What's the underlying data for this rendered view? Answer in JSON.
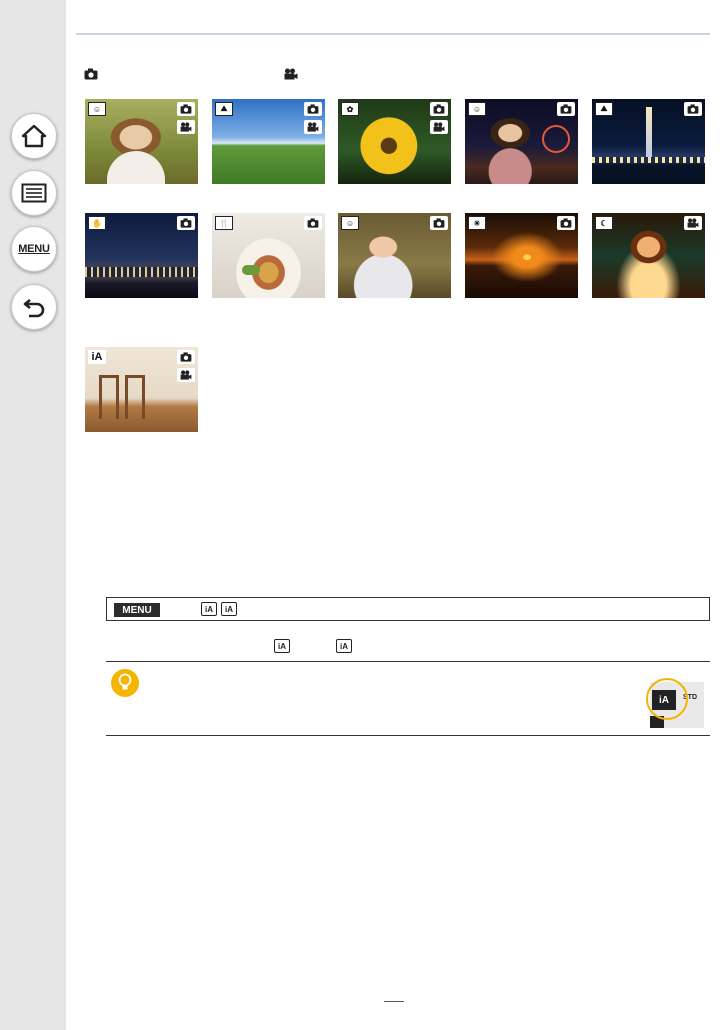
{
  "page": {
    "background": "#ffffff",
    "sidebar_color": "#e6e6e6",
    "rule_color": "#c9d3e3"
  },
  "sidebar": {
    "buttons": [
      {
        "name": "home",
        "icon": "home-icon"
      },
      {
        "name": "contents",
        "icon": "list-icon"
      },
      {
        "name": "menu",
        "icon": "menu-text-icon",
        "label": "MENU"
      },
      {
        "name": "back",
        "icon": "return-arrow-icon"
      }
    ]
  },
  "mode_legend": {
    "photo_icon": "camera-icon",
    "video_icon": "movie-camera-icon"
  },
  "scenes": [
    {
      "id": "portrait",
      "icon": "portrait-scene-icon",
      "photo": true,
      "video": true
    },
    {
      "id": "scenery",
      "icon": "scenery-scene-icon",
      "photo": true,
      "video": true
    },
    {
      "id": "macro",
      "icon": "macro-scene-icon",
      "photo": true,
      "video": true
    },
    {
      "id": "night-portrait",
      "icon": "night-portrait-scene-icon",
      "photo": true,
      "video": false
    },
    {
      "id": "night-scenery",
      "icon": "night-scenery-scene-icon",
      "photo": true,
      "video": false
    },
    {
      "id": "handheld-night",
      "icon": "handheld-night-scene-icon",
      "photo": true,
      "video": false
    },
    {
      "id": "food",
      "icon": "food-scene-icon",
      "photo": true,
      "video": false
    },
    {
      "id": "baby",
      "icon": "baby-scene-icon",
      "photo": true,
      "video": false
    },
    {
      "id": "sunset",
      "icon": "sunset-scene-icon",
      "photo": true,
      "video": false
    },
    {
      "id": "low-light",
      "icon": "low-light-scene-icon",
      "photo": false,
      "video": true
    },
    {
      "id": "normal",
      "icon": "ia-scene-icon",
      "photo": true,
      "video": true,
      "badge_text": "iA"
    }
  ],
  "menu_path": {
    "menu_label": "MENU",
    "icon_a": "iA",
    "icon_b": "iA"
  },
  "setting_row": {
    "icon_a": "iA",
    "icon_b": "iA"
  },
  "tip": {
    "icon": "lightbulb-icon",
    "figure_badge": "iA",
    "figure_text": "STD",
    "highlight_color": "#f4b400"
  }
}
